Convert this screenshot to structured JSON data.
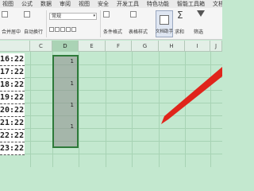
{
  "menu": [
    "视图",
    "公式",
    "数据",
    "审阅",
    "视图",
    "安全",
    "开发工具",
    "特色功能",
    "智能工具箱",
    "文档助手"
  ],
  "ribbon": {
    "merge_center": "合并居中",
    "wrap_text": "自动换行",
    "number_format": "常规",
    "conditional_format": "条件格式",
    "table_style": "表格样式",
    "doc_assistant": "文档助手",
    "sum": "求和",
    "filter": "筛选"
  },
  "columns": [
    "C",
    "D",
    "E",
    "F",
    "G",
    "H",
    "I",
    "J"
  ],
  "selected_column": "D",
  "times": [
    "16:22",
    "17:22",
    "18:22",
    "19:22",
    "20:22",
    "21:22",
    "22:22",
    "23:22"
  ],
  "d_values": [
    "1",
    "1",
    "1",
    "1"
  ],
  "colors": {
    "accent": "#2e7a3a",
    "sheet": "#c3e8cf",
    "arrow": "#e0241b"
  }
}
